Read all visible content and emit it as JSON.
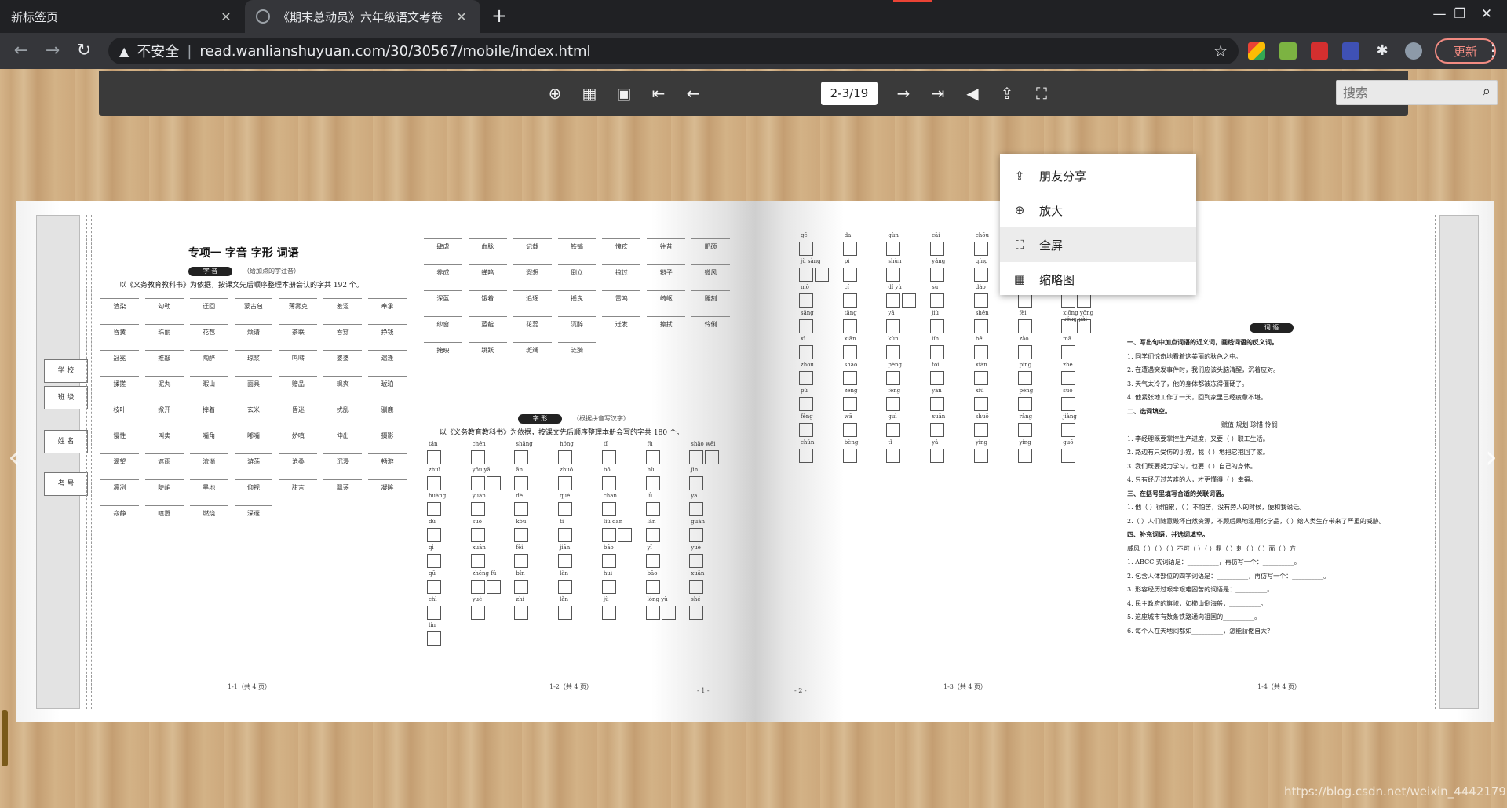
{
  "browser": {
    "tabs": [
      {
        "title": "新标签页",
        "active": false
      },
      {
        "title": "《期末总动员》六年级语文考卷",
        "active": true
      }
    ],
    "new_tab_icon": "+",
    "insecure_label": "不安全",
    "url": "read.wanlianshuyuan.com/30/30567/mobile/index.html",
    "update_label": "更新"
  },
  "reader": {
    "page_indicator": "2-3/19",
    "search_placeholder": "搜索"
  },
  "context_menu": {
    "items": [
      {
        "label": "朋友分享",
        "icon": "share-icon"
      },
      {
        "label": "放大",
        "icon": "zoom-in-icon"
      },
      {
        "label": "全屏",
        "icon": "fullscreen-icon"
      },
      {
        "label": "缩略图",
        "icon": "thumbnail-icon"
      }
    ]
  },
  "left_page": {
    "title": "专项一  字音  字形  词语",
    "section1": {
      "pill": "字 音",
      "note": "（给加点的字注音）",
      "desc": "以《义务教育教科书》为依据，按课文先后顺序整理本册会认的字共 192 个。"
    },
    "section2": {
      "pill": "字 形",
      "note": "（根据拼音写汉字）",
      "desc": "以《义务教育教科书》为依据，按课文先后顺序整理本册会写的字共 180 个。"
    },
    "info_labels": [
      "学 校",
      "班 级",
      "姓 名",
      "考 号"
    ],
    "words_col1": [
      "渲染",
      "勾勒",
      "迂回",
      "蒙古包",
      "薄雾克",
      "羞涩",
      "奉承",
      "昏黄",
      "珠丽",
      "花苞",
      "烦请",
      "茶联",
      "吞穿",
      "挣钱",
      "冠冕",
      "推敲",
      "陶醉",
      "琼浆",
      "鸣啭",
      "婆婆",
      "遗逢",
      "揉搓",
      "泥丸",
      "暇山",
      "面具",
      "赠品",
      "飒爽",
      "琥珀",
      "枝叶",
      "掀开",
      "捧着",
      "玄米",
      "昏迷",
      "扰乱",
      "驯鹿",
      "慢性",
      "叫卖",
      "嘴角",
      "嘟嘴",
      "娇嗔",
      "伸出",
      "摄影",
      "渴望",
      "遮雨",
      "流淌",
      "游荡",
      "沧桑",
      "沉浸",
      "畅游",
      "凛冽",
      "陡峭",
      "旱地",
      "仰视",
      "甜言",
      "飘荡",
      "凝眸",
      "寂静",
      "喧嚣",
      "燃烧",
      "深邃"
    ],
    "footer_left": "1-1（共 4 页）",
    "footer_right": "1-2（共 4 页）",
    "page_num": "- 1 -",
    "words_col2": [
      "肆虐",
      "血脉",
      "记载",
      "铁镐",
      "愧疚",
      "往昔",
      "肥硕",
      "养成",
      "蝉鸣",
      "遐想",
      "倒立",
      "掠过",
      "辫子",
      "微风",
      "深蓝",
      "饿着",
      "追逐",
      "摇曳",
      "雷鸣",
      "崎岖",
      "雕刻",
      "纱窗",
      "蓝靛",
      "花蕊",
      "沉醉",
      "迸发",
      "擦拭",
      "伶俐",
      "掩映",
      "跳跃",
      "斑斓",
      "涟漪"
    ],
    "pinyin": [
      "tán",
      "chén",
      "shāng",
      "hóng",
      "tǐ",
      "fǔ",
      "shāo wěi",
      "zhuī",
      "yǒu yǎ",
      "ǎn",
      "zhuō",
      "bō",
      "hù",
      "jìn",
      "huáng",
      "yuán",
      "dé",
      "què",
      "chān",
      "lǜ",
      "yā",
      "dú",
      "suǒ",
      "kòu",
      "tí",
      "liú dān",
      "lǎn",
      "guàn",
      "qì",
      "xuān",
      "fěi",
      "jiān",
      "bāo",
      "yǐ",
      "yuè",
      "qū",
      "zhēng fú",
      "bǐn",
      "làn",
      "huì",
      "bāo",
      "xuān",
      "chì",
      "yuè",
      "zhí",
      "lǎn",
      "jù",
      "lóng yù",
      "shé",
      "lín"
    ]
  },
  "right_page": {
    "section_pill": "词 语",
    "q1_heading": "一、写出句中加点词语的近义词，画线词语的反义词。",
    "q1_items": [
      "1. 同学们惊奇地看着这美丽的秋色之中。",
      "2. 在遭遇突发事件时，我们应该头脑清醒，沉着应对。",
      "3. 天气太冷了，他的身体都被冻得僵硬了。",
      "4. 他紧张地工作了一天，回到家里已经疲惫不堪。"
    ],
    "q2_heading": "二、选词填空。",
    "q2_options": "赋值    规划    珍惜    怜悯",
    "q2_items": [
      "1. 李经理既要掌控生产进度，又要（      ）职工生活。",
      "2. 路边有只受伤的小猫，我（      ）地把它抱回了家。",
      "3. 我们既要努力学习，也要（      ）自己的身体。",
      "4. 只有经历过苦难的人，才更懂得（      ）幸福。"
    ],
    "q3_heading": "三、在括号里填写合适的关联词语。",
    "q3_items": [
      "1. 他（    ）很怕累，（    ）不怕苦，没有旁人的时候，便和我说话。",
      "2.（    ）人们随意毁坏自然资源，不顾后果地滥用化学品，（    ）给人类生存带来了严重的威胁。"
    ],
    "q4_heading": "四、补充词语，并选词填空。",
    "q4_items": [
      "威风（  ）（  ）（  ）不可（  ）（  ）鼎（  ）刺（  ）（  ）面（  ）方",
      "1. ABCC 式词语是：__________，再仿写一个：__________。",
      "2. 包含人体部位的四字词语是：__________，再仿写一个：__________。",
      "3. 形容经历过艰辛艰难困苦的词语是：__________。",
      "4. 民主政府的旗帜，如櫛山倒海般，__________。",
      "5. 这座城市有数条铁路通向祖国的__________。",
      "6. 每个人在天地间都如__________，怎能骄傲自大？"
    ],
    "footer_left": "1-3（共 4 页）",
    "footer_right": "1-4（共 4 页）",
    "page_num": "- 2 -",
    "pinyin": [
      "gē",
      "da",
      "gùn",
      "cāi",
      "chōu",
      "duō",
      "tuí",
      "jù sàng",
      "pì",
      "shùn",
      "yǎng",
      "qíng",
      "jié",
      "bān",
      "mō",
      "cí",
      "dǐ yù",
      "sù",
      "dào",
      "péi",
      "pào xiāo",
      "sāng",
      "tāng",
      "yā",
      "jiù",
      "shēn",
      "fèi",
      "xiōng yǒng péng pài",
      "xī",
      "xiān",
      "kùn",
      "lín",
      "hēi",
      "zào",
      "mā",
      "zhōu",
      "shào",
      "péng",
      "tōi",
      "xián",
      "píng",
      "zhè",
      "pǔ",
      "zēng",
      "fēng",
      "yán",
      "xiù",
      "péng",
      "suō",
      "fěng",
      "wā",
      "guì",
      "xuān",
      "shuō",
      "rǎng",
      "jiàng",
      "chún",
      "bèng",
      "tǐ",
      "yǎ",
      "ying",
      "ying",
      "guō"
    ]
  },
  "watermark": "https://blog.csdn.net/weixin_44421798"
}
